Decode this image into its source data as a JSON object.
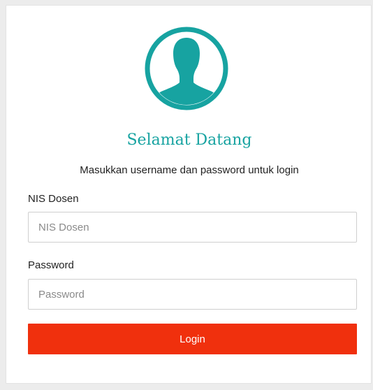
{
  "colors": {
    "accent": "#17a3a1",
    "button": "#f0300d",
    "background": "#ececec",
    "card": "#ffffff"
  },
  "avatar": {
    "icon": "user-silhouette-icon"
  },
  "login": {
    "title": "Selamat Datang",
    "subtitle": "Masukkan username dan password untuk login",
    "nis_label": "NIS Dosen",
    "nis_placeholder": "NIS Dosen",
    "nis_value": "",
    "password_label": "Password",
    "password_placeholder": "Password",
    "password_value": "",
    "button_label": "Login"
  }
}
